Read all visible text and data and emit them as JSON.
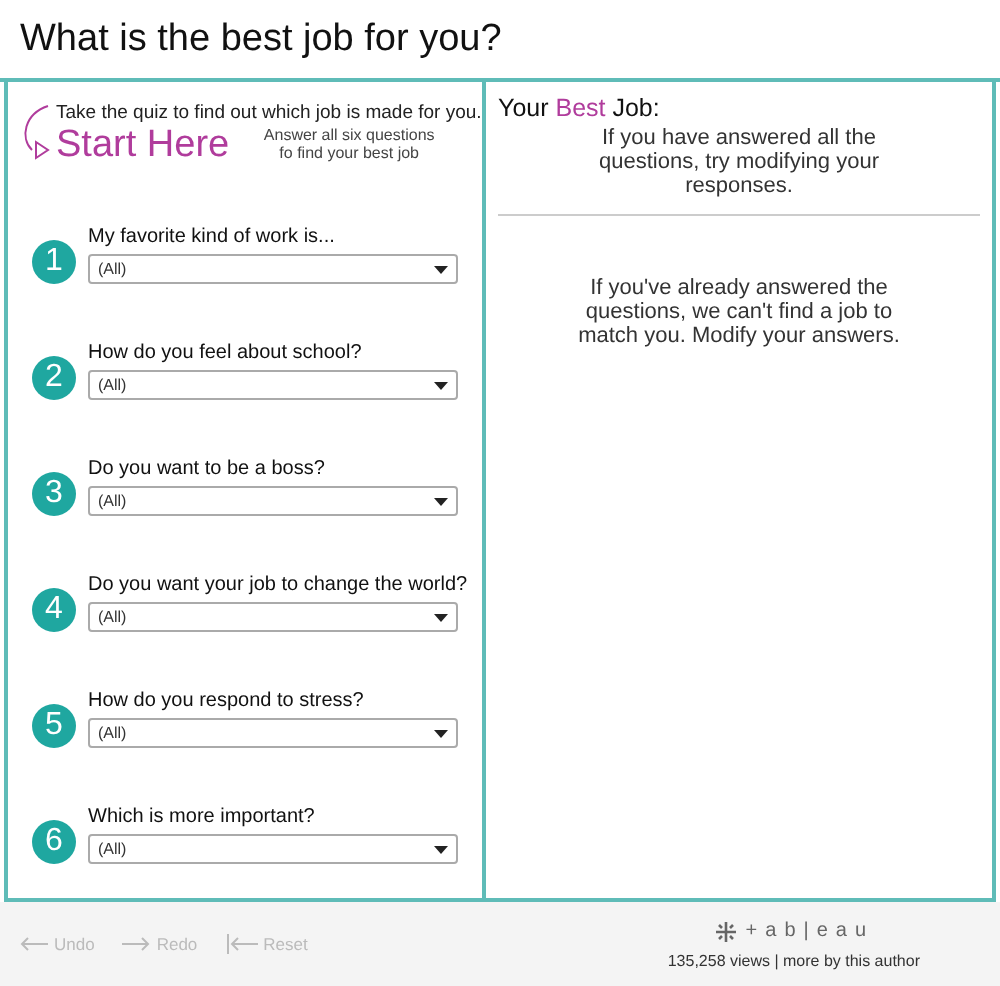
{
  "title": "What is the best job for you?",
  "intro": "Take the quiz to find out which job is made for you.",
  "start": "Start Here",
  "start_hint": "Answer all six questions fo find your best job",
  "questions": [
    {
      "number": "1",
      "label": "My favorite kind of work is...",
      "value": "(All)"
    },
    {
      "number": "2",
      "label": "How do you feel about school?",
      "value": "(All)"
    },
    {
      "number": "3",
      "label": "Do you want to be a boss?",
      "value": "(All)"
    },
    {
      "number": "4",
      "label": "Do you want your job to change the world?",
      "value": "(All)"
    },
    {
      "number": "5",
      "label": "How do you respond to stress?",
      "value": "(All)"
    },
    {
      "number": "6",
      "label": "Which is more important?",
      "value": "(All)"
    }
  ],
  "result": {
    "heading": [
      {
        "text": "Your ",
        "highlight": false
      },
      {
        "text": "Best",
        "highlight": true
      },
      {
        "text": " Job:",
        "highlight": false
      }
    ],
    "message": "If you have answered all the questions, try modifying your responses.",
    "no_match": "If you've already answered the questions, we can't find a job to match you. Modify your answers."
  },
  "toolbar": [
    {
      "kind": "undo",
      "label": "Undo",
      "disabled": true
    },
    {
      "kind": "redo",
      "label": "Redo",
      "disabled": true
    },
    {
      "kind": "reset",
      "label": "Reset",
      "disabled": true
    }
  ],
  "brand": "+ab|eau",
  "stats": "135,258 views | more by this author"
}
